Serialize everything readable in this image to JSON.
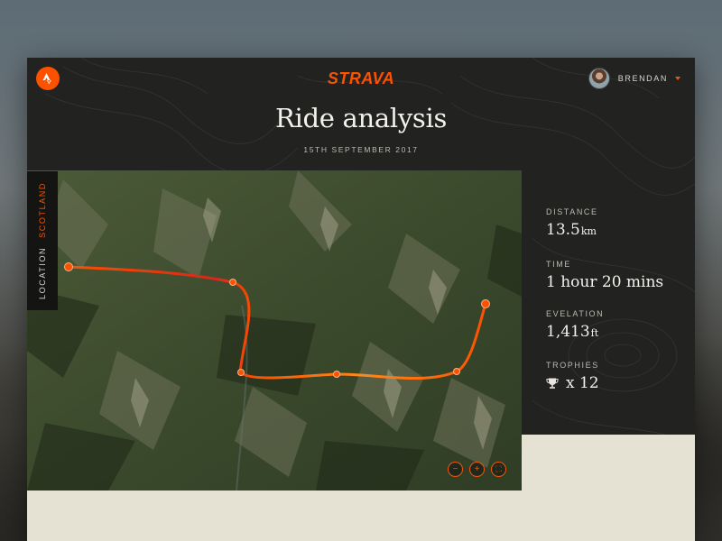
{
  "header": {
    "brand": "STRAVA",
    "user_name": "BRENDAN",
    "logo_icon": "strava-logo-icon",
    "accent_color": "#fc5200"
  },
  "page": {
    "title": "Ride analysis",
    "date": "15TH SEPTEMBER 2017"
  },
  "location": {
    "label": "LOCATION",
    "value": "SCOTLAND"
  },
  "map": {
    "zoom_controls": [
      {
        "name": "zoom-out-button",
        "symbol": "−"
      },
      {
        "name": "zoom-in-button",
        "symbol": "+"
      },
      {
        "name": "fullscreen-button",
        "symbol": "⛶"
      }
    ]
  },
  "stats": {
    "distance": {
      "label": "DISTANCE",
      "value": "13.5",
      "unit": "km"
    },
    "time": {
      "label": "TIME",
      "value": "1 hour 20 mins"
    },
    "elevation": {
      "label": "EVELATION",
      "value": "1,413",
      "unit": "ft"
    },
    "trophies": {
      "label": "TROPHIES",
      "value": "x 12",
      "icon": "trophy-icon"
    }
  }
}
